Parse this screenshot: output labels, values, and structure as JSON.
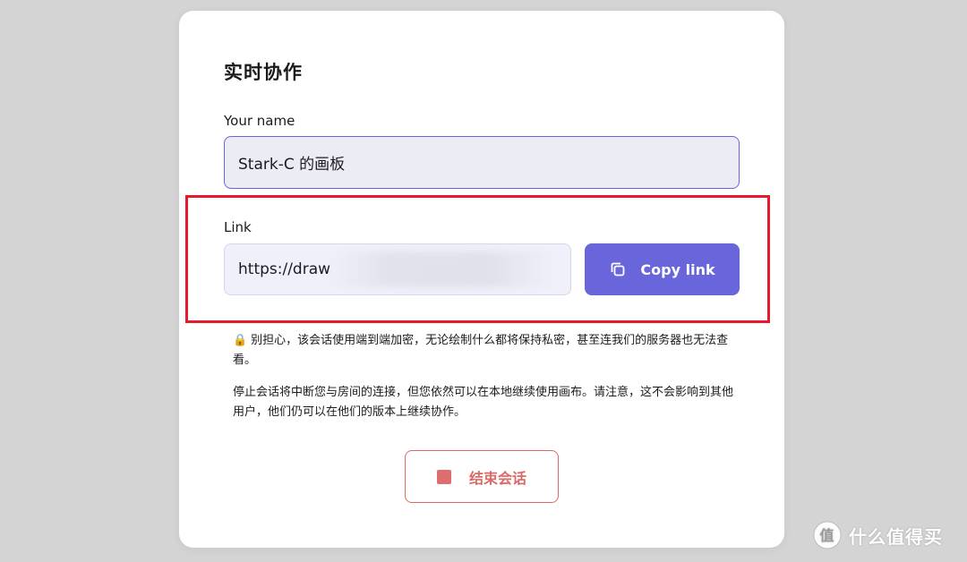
{
  "dialog": {
    "title": "实时协作",
    "name_field": {
      "label": "Your name",
      "value": "Stark-C 的画板"
    },
    "link_field": {
      "label": "Link",
      "value": "https://draw"
    },
    "copy_button": {
      "label": "Copy link",
      "icon": "copy-icon"
    },
    "privacy_note": {
      "icon": "lock-icon",
      "emoji": "🔒",
      "text": "别担心，该会话使用端到端加密，无论绘制什么都将保持私密，甚至连我们的服务器也无法查看。"
    },
    "stop_note": "停止会话将中断您与房间的连接，但您依然可以在本地继续使用画布。请注意，这不会影响到其他用户，他们仍可以在他们的版本上继续协作。",
    "end_button": {
      "label": "结束会话",
      "icon": "stop-icon"
    }
  },
  "watermark": {
    "text": "什么值得买",
    "icon": "zhide-logo"
  },
  "colors": {
    "primary": "#6965db",
    "danger": "#db6965",
    "highlight": "#e8192c",
    "background": "#d4d4d4"
  }
}
